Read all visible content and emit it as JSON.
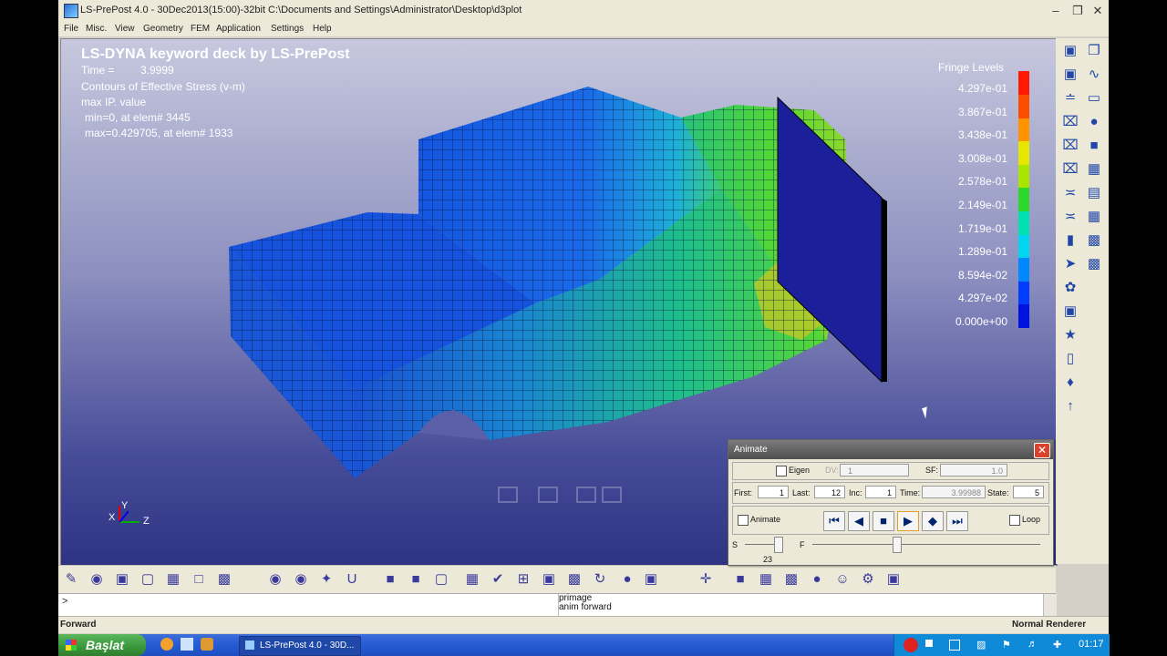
{
  "window": {
    "title": "LS-PrePost 4.0 - 30Dec2013(15:00)-32bit C:\\Documents and Settings\\Administrator\\Desktop\\d3plot",
    "menu": [
      "File",
      "Misc.",
      "View",
      "Geometry",
      "FEM",
      "Application",
      "Settings",
      "Help"
    ]
  },
  "viewport": {
    "heading": "LS-DYNA keyword deck by LS-PrePost",
    "time_label": "Time =",
    "time_value": "3.9999",
    "contours": "Contours of Effective Stress (v-m)",
    "max_ip": "max IP. value",
    "min_line": "min=0, at elem# 3445",
    "max_line": "max=0.429705, at elem# 1933",
    "axis_labels": {
      "x": "X",
      "y": "Y",
      "z": "Z"
    }
  },
  "fringe": {
    "title": "Fringe Levels",
    "levels": [
      "4.297e-01",
      "3.867e-01",
      "3.438e-01",
      "3.008e-01",
      "2.578e-01",
      "2.149e-01",
      "1.719e-01",
      "1.289e-01",
      "8.594e-02",
      "4.297e-02",
      "0.000e+00"
    ],
    "colors": [
      "#ff1a00",
      "#ff4d00",
      "#ff9400",
      "#e6e600",
      "#a8e600",
      "#2bd82b",
      "#00e0b0",
      "#00d6f0",
      "#0089ff",
      "#003dff",
      "#0012e0"
    ]
  },
  "animate_dialog": {
    "title": "Animate",
    "eigen_label": "Eigen",
    "dv_label": "DV:",
    "dv_value": "1",
    "sf_label": "SF:",
    "sf_value": "1.0",
    "first_label": "First:",
    "first_value": "1",
    "last_label": "Last:",
    "last_value": "12",
    "inc_label": "Inc:",
    "inc_value": "1",
    "time_label": "Time:",
    "time_value": "3.99988",
    "state_label": "State:",
    "state_value": "5",
    "animate_label": "Animate",
    "loop_label": "Loop",
    "s_label": "S",
    "s_value": "23",
    "f_label": "F"
  },
  "command": {
    "prompt": ">",
    "history": [
      "primage",
      "anim forward"
    ]
  },
  "status": {
    "left": "Forward",
    "right": "Normal Renderer"
  },
  "taskbar": {
    "start": "Başlat",
    "task": "LS-PrePost 4.0 - 30D...",
    "clock": "01:17"
  },
  "colors": {
    "viewport_top": "#c7c8de",
    "viewport_bottom": "#2e3482",
    "taskbar": "#245ad4"
  }
}
